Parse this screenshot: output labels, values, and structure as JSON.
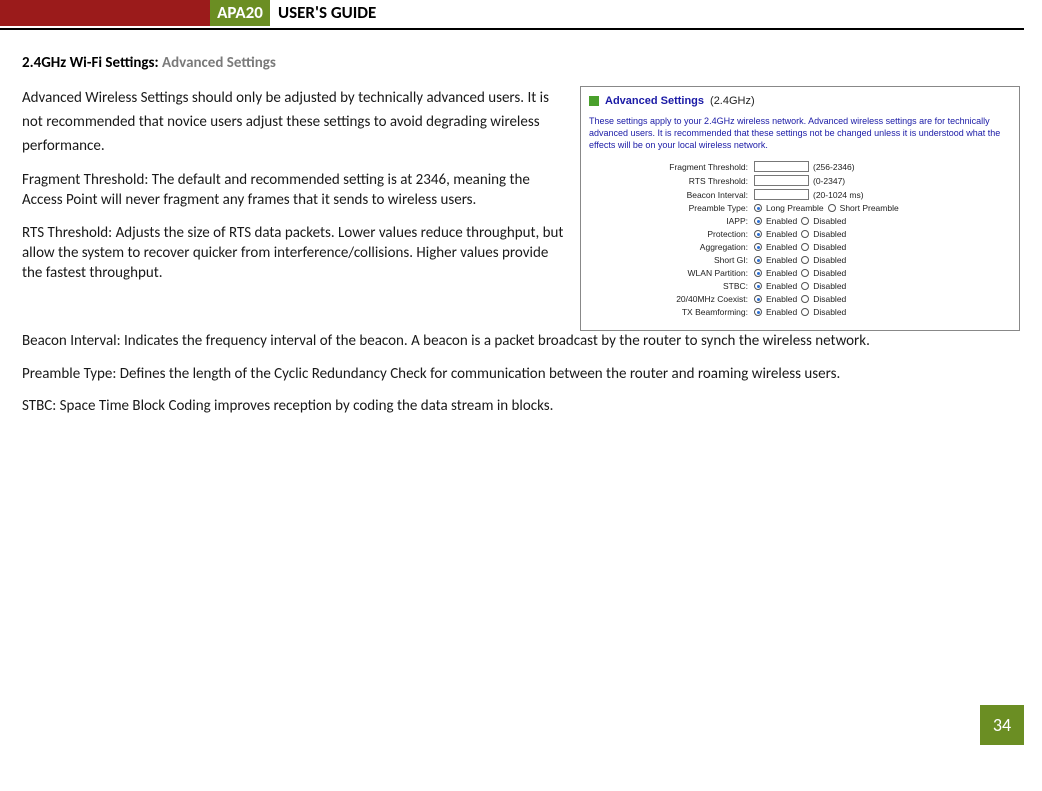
{
  "header": {
    "brand": "APA20",
    "title": "USER'S GUIDE"
  },
  "section": {
    "prefix": "2.4GHz Wi-Fi Settings: ",
    "title": "Advanced Settings"
  },
  "paras_left": [
    "Advanced Wireless Settings should only be adjusted by technically advanced users. It is not recommended that novice users adjust these settings to avoid degrading wireless performance.",
    "Fragment Threshold: The default and recommended setting is at 2346, meaning the Access Point will never fragment any frames that it sends to wireless users.",
    "RTS Threshold: Adjusts the size of RTS data packets. Lower values reduce throughput, but allow the system to recover quicker from interference/collisions. Higher values provide the fastest throughput."
  ],
  "paras_full": [
    "Beacon Interval: Indicates the frequency interval of the beacon. A beacon is a packet broadcast by the router to synch the wireless network.",
    "Preamble Type: Defines the length of the Cyclic Redundancy Check for communication between the router and roaming wireless users.",
    "STBC: Space Time Block Coding improves reception by coding the data stream in blocks."
  ],
  "shot": {
    "heading_bold": "Advanced Settings",
    "heading_paren": "(2.4GHz)",
    "desc": "These settings apply to your 2.4GHz wireless network. Advanced wireless settings are for technically advanced users. It is recommended that these settings not be changed unless it is understood what the effects will be on your local wireless network.",
    "rows_input": [
      {
        "label": "Fragment Threshold:",
        "hint": "(256-2346)"
      },
      {
        "label": "RTS Threshold:",
        "hint": "(0-2347)"
      },
      {
        "label": "Beacon Interval:",
        "hint": "(20-1024 ms)"
      }
    ],
    "row_preamble": {
      "label": "Preamble Type:",
      "opt1": "Long Preamble",
      "opt2": "Short Preamble"
    },
    "rows_ed": [
      {
        "label": "IAPP:"
      },
      {
        "label": "Protection:"
      },
      {
        "label": "Aggregation:"
      },
      {
        "label": "Short GI:"
      },
      {
        "label": "WLAN Partition:"
      },
      {
        "label": "STBC:"
      },
      {
        "label": "20/40MHz Coexist:"
      },
      {
        "label": "TX Beamforming:"
      }
    ],
    "enabled_label": "Enabled",
    "disabled_label": "Disabled"
  },
  "page_number": "34"
}
